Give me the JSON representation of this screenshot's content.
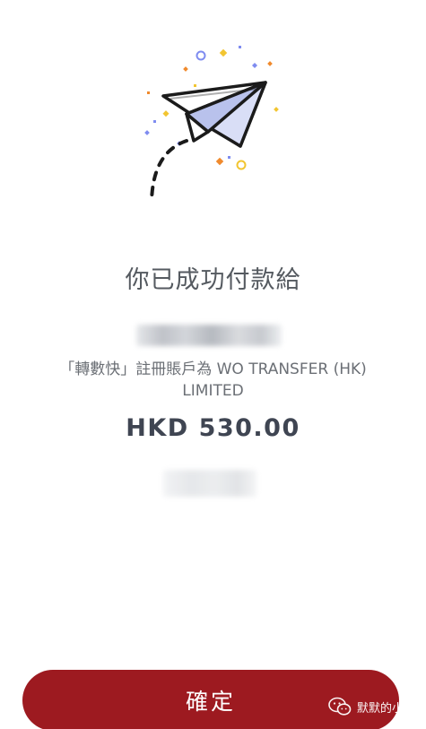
{
  "success": {
    "title": "你已成功付款給",
    "recipient_description": "「轉數快」註冊賬戶為 WO TRANSFER (HK) LIMITED",
    "amount": "HKD 530.00"
  },
  "actions": {
    "confirm_label": "確定"
  },
  "watermark": {
    "text": "默默的小站"
  },
  "colors": {
    "primary_button": "#9d1a20",
    "title_text": "#555a60",
    "amount_text": "#3f4552"
  },
  "icons": {
    "illustration": "paper-plane-icon",
    "watermark": "wechat-icon"
  }
}
